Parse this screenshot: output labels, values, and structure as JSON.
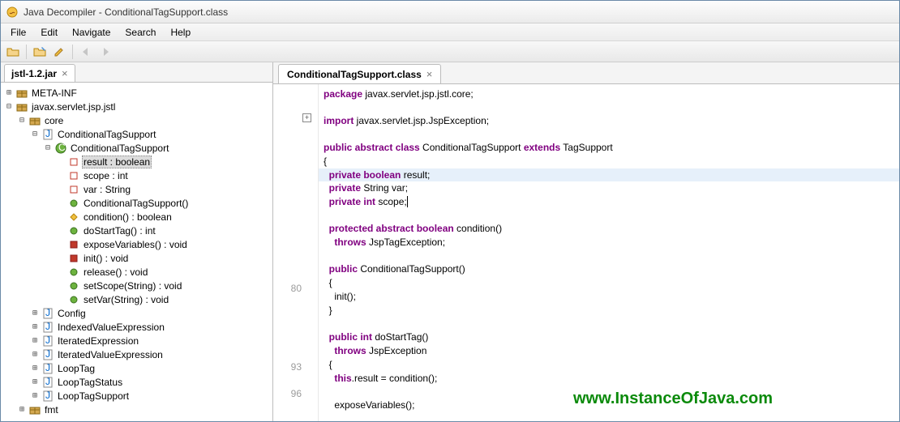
{
  "window": {
    "title": "Java Decompiler - ConditionalTagSupport.class"
  },
  "menu": {
    "file": "File",
    "edit": "Edit",
    "navigate": "Navigate",
    "search": "Search",
    "help": "Help"
  },
  "leftTab": {
    "label": "jstl-1.2.jar",
    "close": "×"
  },
  "tree": {
    "metainf": "META-INF",
    "pkg": "javax.servlet.jsp.jstl",
    "core": "core",
    "cts": "ConditionalTagSupport",
    "cts2": "ConditionalTagSupport",
    "result": "result : boolean",
    "scope": "scope : int",
    "var": "var : String",
    "ctor": "ConditionalTagSupport()",
    "cond": "condition() : boolean",
    "dostart": "doStartTag() : int",
    "expose": "exposeVariables() : void",
    "init": "init() : void",
    "release": "release() : void",
    "setscope": "setScope(String) : void",
    "setvar": "setVar(String) : void",
    "config": "Config",
    "ive": "IndexedValueExpression",
    "ite": "IteratedExpression",
    "itve": "IteratedValueExpression",
    "looptag": "LoopTag",
    "looptagstatus": "LoopTagStatus",
    "looptagsupport": "LoopTagSupport",
    "fmt": "fmt"
  },
  "rightTab": {
    "label": "ConditionalTagSupport.class",
    "close": "×"
  },
  "gutter": {
    "l80": "80",
    "l93": "93",
    "l96": "96"
  },
  "code": {
    "l1a": "package",
    "l1b": " javax.servlet.jsp.jstl.core;",
    "l3a": "import",
    "l3b": " javax.servlet.jsp.JspException;",
    "l5a": "public abstract class",
    "l5b": " ConditionalTagSupport ",
    "l5c": "extends",
    "l5d": " TagSupport",
    "l6": "{",
    "l7a": "  private boolean",
    "l7b": " result;",
    "l8a": "  private",
    "l8b": " String var;",
    "l9a": "  private int",
    "l9b": " scope;",
    "l11a": "  protected abstract boolean",
    "l11b": " condition()",
    "l12a": "    throws",
    "l12b": " JspTagException;",
    "l14a": "  public",
    "l14b": " ConditionalTagSupport()",
    "l15": "  {",
    "l16": "    init();",
    "l17": "  }",
    "l19a": "  public int",
    "l19b": " doStartTag()",
    "l20a": "    throws",
    "l20b": " JspException",
    "l21": "  {",
    "l22a": "    this",
    "l22b": ".result = condition();",
    "l24": "    exposeVariables();"
  },
  "watermark": "www.InstanceOfJava.com"
}
